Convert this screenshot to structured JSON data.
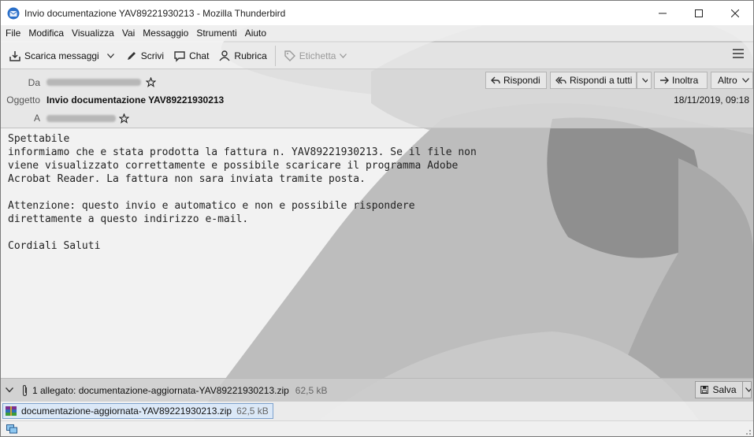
{
  "window": {
    "title": "Invio documentazione YAV89221930213 - Mozilla Thunderbird"
  },
  "menu": [
    "File",
    "Modifica",
    "Visualizza",
    "Vai",
    "Messaggio",
    "Strumenti",
    "Aiuto"
  ],
  "toolbar": {
    "get_messages": "Scarica messaggi",
    "write": "Scrivi",
    "chat": "Chat",
    "address_book": "Rubrica",
    "tag": "Etichetta"
  },
  "header": {
    "from_label": "Da",
    "subject_label": "Oggetto",
    "to_label": "A",
    "subject": "Invio documentazione YAV89221930213",
    "date": "18/11/2019, 09:18",
    "reply": "Rispondi",
    "reply_all": "Rispondi a tutti",
    "forward": "Inoltra",
    "more": "Altro"
  },
  "body": {
    "text": "Spettabile\ninformiamo che e stata prodotta la fattura n. YAV89221930213. Se il file non\nviene visualizzato correttamente e possibile scaricare il programma Adobe\nAcrobat Reader. La fattura non sara inviata tramite posta.\n\nAttenzione: questo invio e automatico e non e possibile rispondere\ndirettamente a questo indirizzo e-mail.\n\nCordiali Saluti"
  },
  "attachments": {
    "summary": "1 allegato: documentazione-aggiornata-YAV89221930213.zip",
    "summary_size": "62,5 kB",
    "save": "Salva",
    "items": [
      {
        "name": "documentazione-aggiornata-YAV89221930213.zip",
        "size": "62,5 kB"
      }
    ]
  }
}
